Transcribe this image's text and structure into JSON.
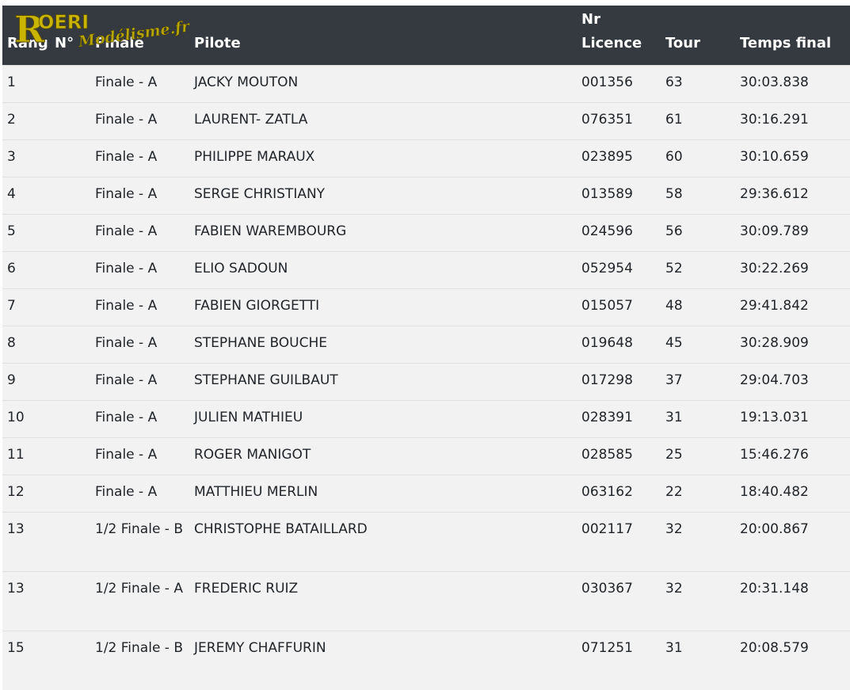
{
  "logo": {
    "brand": "OERI",
    "initial": "R",
    "tagline": "Modélisme.fr"
  },
  "table": {
    "headers": {
      "rang": "Rang",
      "num": "N°",
      "finale": "Finale",
      "pilote": "Pilote",
      "licence_top": "Nr",
      "licence_bottom": "Licence",
      "tour": "Tour",
      "temps": "Temps final"
    },
    "rows": [
      {
        "rang": "1",
        "num": "",
        "finale": "Finale - A",
        "pilote": "JACKY MOUTON",
        "licence": "001356",
        "tour": "63",
        "temps": "30:03.838"
      },
      {
        "rang": "2",
        "num": "",
        "finale": "Finale - A",
        "pilote": "LAURENT- ZATLA",
        "licence": "076351",
        "tour": "61",
        "temps": "30:16.291"
      },
      {
        "rang": "3",
        "num": "",
        "finale": "Finale - A",
        "pilote": "PHILIPPE MARAUX",
        "licence": "023895",
        "tour": "60",
        "temps": "30:10.659"
      },
      {
        "rang": "4",
        "num": "",
        "finale": "Finale - A",
        "pilote": "SERGE CHRISTIANY",
        "licence": "013589",
        "tour": "58",
        "temps": "29:36.612"
      },
      {
        "rang": "5",
        "num": "",
        "finale": "Finale - A",
        "pilote": "FABIEN WAREMBOURG",
        "licence": "024596",
        "tour": "56",
        "temps": "30:09.789"
      },
      {
        "rang": "6",
        "num": "",
        "finale": "Finale - A",
        "pilote": "ELIO SADOUN",
        "licence": "052954",
        "tour": "52",
        "temps": "30:22.269"
      },
      {
        "rang": "7",
        "num": "",
        "finale": "Finale - A",
        "pilote": "FABIEN GIORGETTI",
        "licence": "015057",
        "tour": "48",
        "temps": "29:41.842"
      },
      {
        "rang": "8",
        "num": "",
        "finale": "Finale - A",
        "pilote": "STEPHANE BOUCHE",
        "licence": "019648",
        "tour": "45",
        "temps": "30:28.909"
      },
      {
        "rang": "9",
        "num": "",
        "finale": "Finale - A",
        "pilote": "STEPHANE GUILBAUT",
        "licence": "017298",
        "tour": "37",
        "temps": "29:04.703"
      },
      {
        "rang": "10",
        "num": "",
        "finale": "Finale - A",
        "pilote": "JULIEN MATHIEU",
        "licence": "028391",
        "tour": "31",
        "temps": "19:13.031"
      },
      {
        "rang": "11",
        "num": "",
        "finale": "Finale - A",
        "pilote": "ROGER MANIGOT",
        "licence": "028585",
        "tour": "25",
        "temps": "15:46.276"
      },
      {
        "rang": "12",
        "num": "",
        "finale": "Finale - A",
        "pilote": "MATTHIEU MERLIN",
        "licence": "063162",
        "tour": "22",
        "temps": "18:40.482"
      },
      {
        "rang": "13",
        "num": "",
        "finale": "1/2 Finale - B",
        "pilote": "CHRISTOPHE BATAILLARD",
        "licence": "002117",
        "tour": "32",
        "temps": "20:00.867"
      },
      {
        "rang": "13",
        "num": "",
        "finale": "1/2 Finale - A",
        "pilote": "FREDERIC RUIZ",
        "licence": "030367",
        "tour": "32",
        "temps": "20:31.148"
      },
      {
        "rang": "15",
        "num": "",
        "finale": "1/2 Finale - B",
        "pilote": "JEREMY CHAFFURIN",
        "licence": "071251",
        "tour": "31",
        "temps": "20:08.579"
      }
    ]
  },
  "colors": {
    "header_bg": "#343a40",
    "row_bg": "#f2f2f2",
    "logo_brand": "#c9b400",
    "logo_tagline": "#b8a600"
  }
}
